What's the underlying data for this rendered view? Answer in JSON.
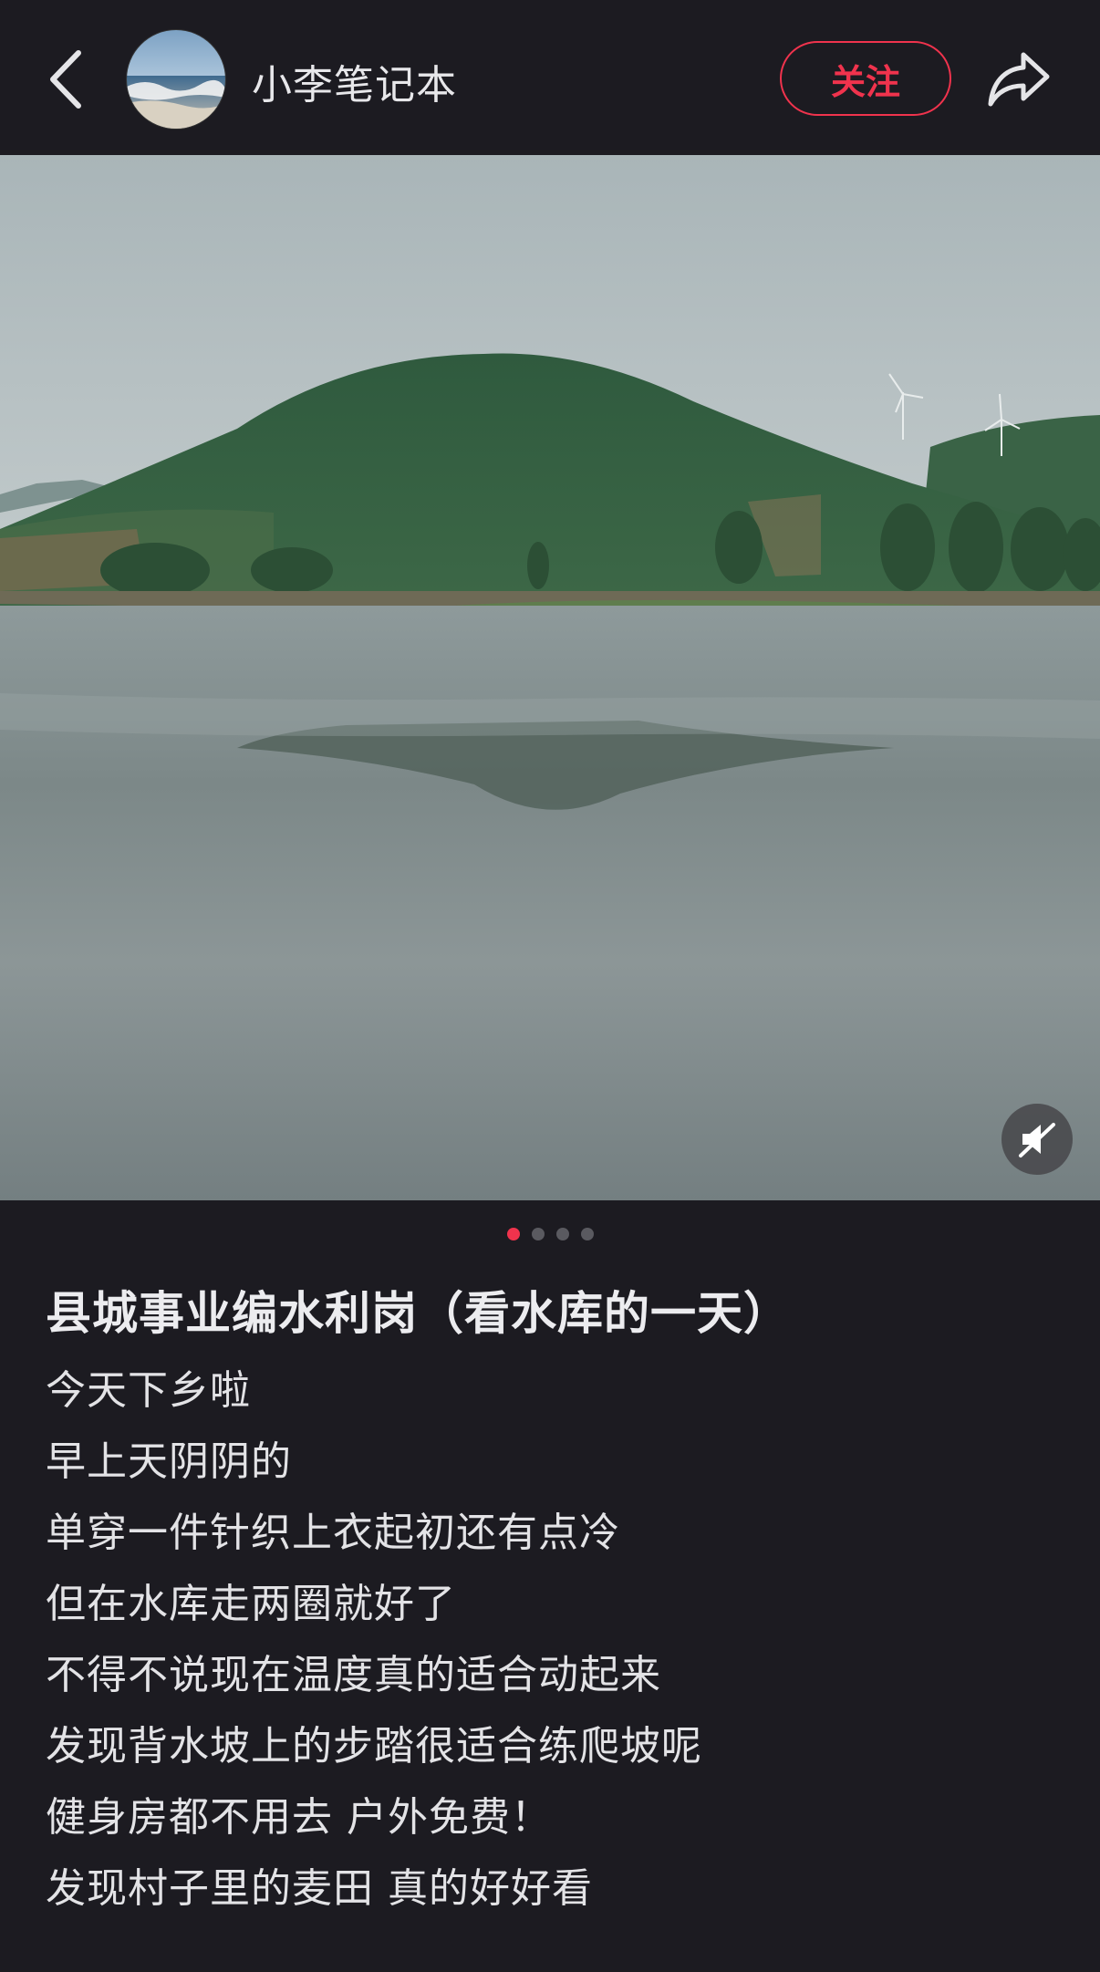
{
  "header": {
    "username": "小李笔记本",
    "follow_label": "关注",
    "back_icon": "chevron-left-icon",
    "share_icon": "share-arrow-icon"
  },
  "media": {
    "image_count": 4,
    "active_index": 0,
    "mute_icon": "speaker-muted-icon"
  },
  "post": {
    "title": "县城事业编水利岗（看水库的一天）",
    "lines": [
      "今天下乡啦",
      "早上天阴阴的",
      "单穿一件针织上衣起初还有点冷",
      "但在水库走两圈就好了",
      "不得不说现在温度真的适合动起来",
      "发现背水坡上的步踏很适合练爬坡呢",
      "健身房都不用去 户外免费！",
      "发现村子里的麦田 真的好好看"
    ]
  },
  "colors": {
    "background": "#1c1b21",
    "accent": "#f0334d",
    "text": "#e7e7ea"
  }
}
